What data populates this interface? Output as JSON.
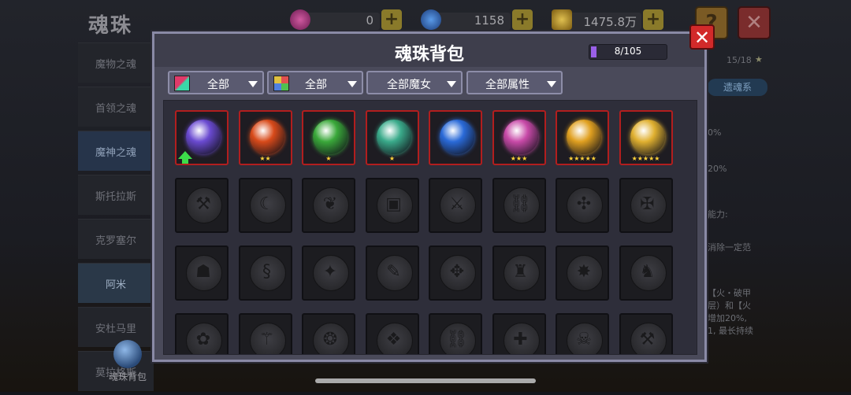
{
  "header": {
    "title": "魂珠",
    "currency": [
      {
        "icon": "pink-gem-icon",
        "value": "0",
        "color": "#c0408a"
      },
      {
        "icon": "blue-gem-icon",
        "value": "1158",
        "color": "#3a7ad0"
      },
      {
        "icon": "gold-coin-icon",
        "value": "1475.8万",
        "color": "#c8a02a"
      }
    ],
    "help_label": "?",
    "close_label": "✕"
  },
  "sidebar": {
    "items": [
      {
        "label": "魔物之魂"
      },
      {
        "label": "首领之魂"
      },
      {
        "label": "魔神之魂"
      },
      {
        "label": "斯托拉斯"
      },
      {
        "label": "克罗塞尔"
      },
      {
        "label": "阿米"
      },
      {
        "label": "安杜马里"
      },
      {
        "label": "莫拉格斯"
      }
    ],
    "bag_label": "魂珠背包"
  },
  "right_panel": {
    "progress": "15/18",
    "star": "★",
    "tab": "遗魂系",
    "lines": [
      "0%",
      "20%",
      "能力:",
      "消除一定范",
      "【火・破甲",
      "层）和【火",
      "增加20%,",
      "1, 最长持续"
    ]
  },
  "modal": {
    "title": "魂珠背包",
    "capacity": "8/105",
    "capacity_fraction": 0.076,
    "close_label": "✕",
    "filters": [
      {
        "label": "全部",
        "icon": "color-swatch-icon"
      },
      {
        "label": "全部",
        "icon": "element-grid-icon"
      },
      {
        "label": "全部魔女"
      },
      {
        "label": "全部属性"
      }
    ],
    "items": [
      {
        "name": "purple-crystal-orb",
        "stars": 0,
        "upgrade": true,
        "color": "#6a4ad0"
      },
      {
        "name": "fire-sword-orb",
        "stars": 2,
        "upgrade": false,
        "color": "#d84a1a"
      },
      {
        "name": "green-mace-orb",
        "stars": 1,
        "upgrade": false,
        "color": "#3aa83a"
      },
      {
        "name": "green-serpent-orb",
        "stars": 1,
        "upgrade": false,
        "color": "#3aaa8a"
      },
      {
        "name": "blue-blade-orb",
        "stars": 0,
        "upgrade": false,
        "color": "#2a6ad8"
      },
      {
        "name": "magenta-rune-orb",
        "stars": 3,
        "upgrade": false,
        "color": "#c84aa8"
      },
      {
        "name": "golden-lion-orb",
        "stars": 5,
        "upgrade": false,
        "color": "#e0a020"
      },
      {
        "name": "blue-crystal-orb",
        "stars": 5,
        "upgrade": false,
        "color": "#e0b030"
      }
    ],
    "empty_slots": [
      "axe",
      "claw",
      "leaf",
      "shield",
      "sword",
      "chain",
      "rune",
      "mace",
      "mask",
      "worm",
      "flame",
      "scroll",
      "drill",
      "totem",
      "spike",
      "beast",
      "flower",
      "skull-staff",
      "swirl",
      "twin",
      "chain",
      "cross",
      "demon",
      "hammer"
    ]
  }
}
